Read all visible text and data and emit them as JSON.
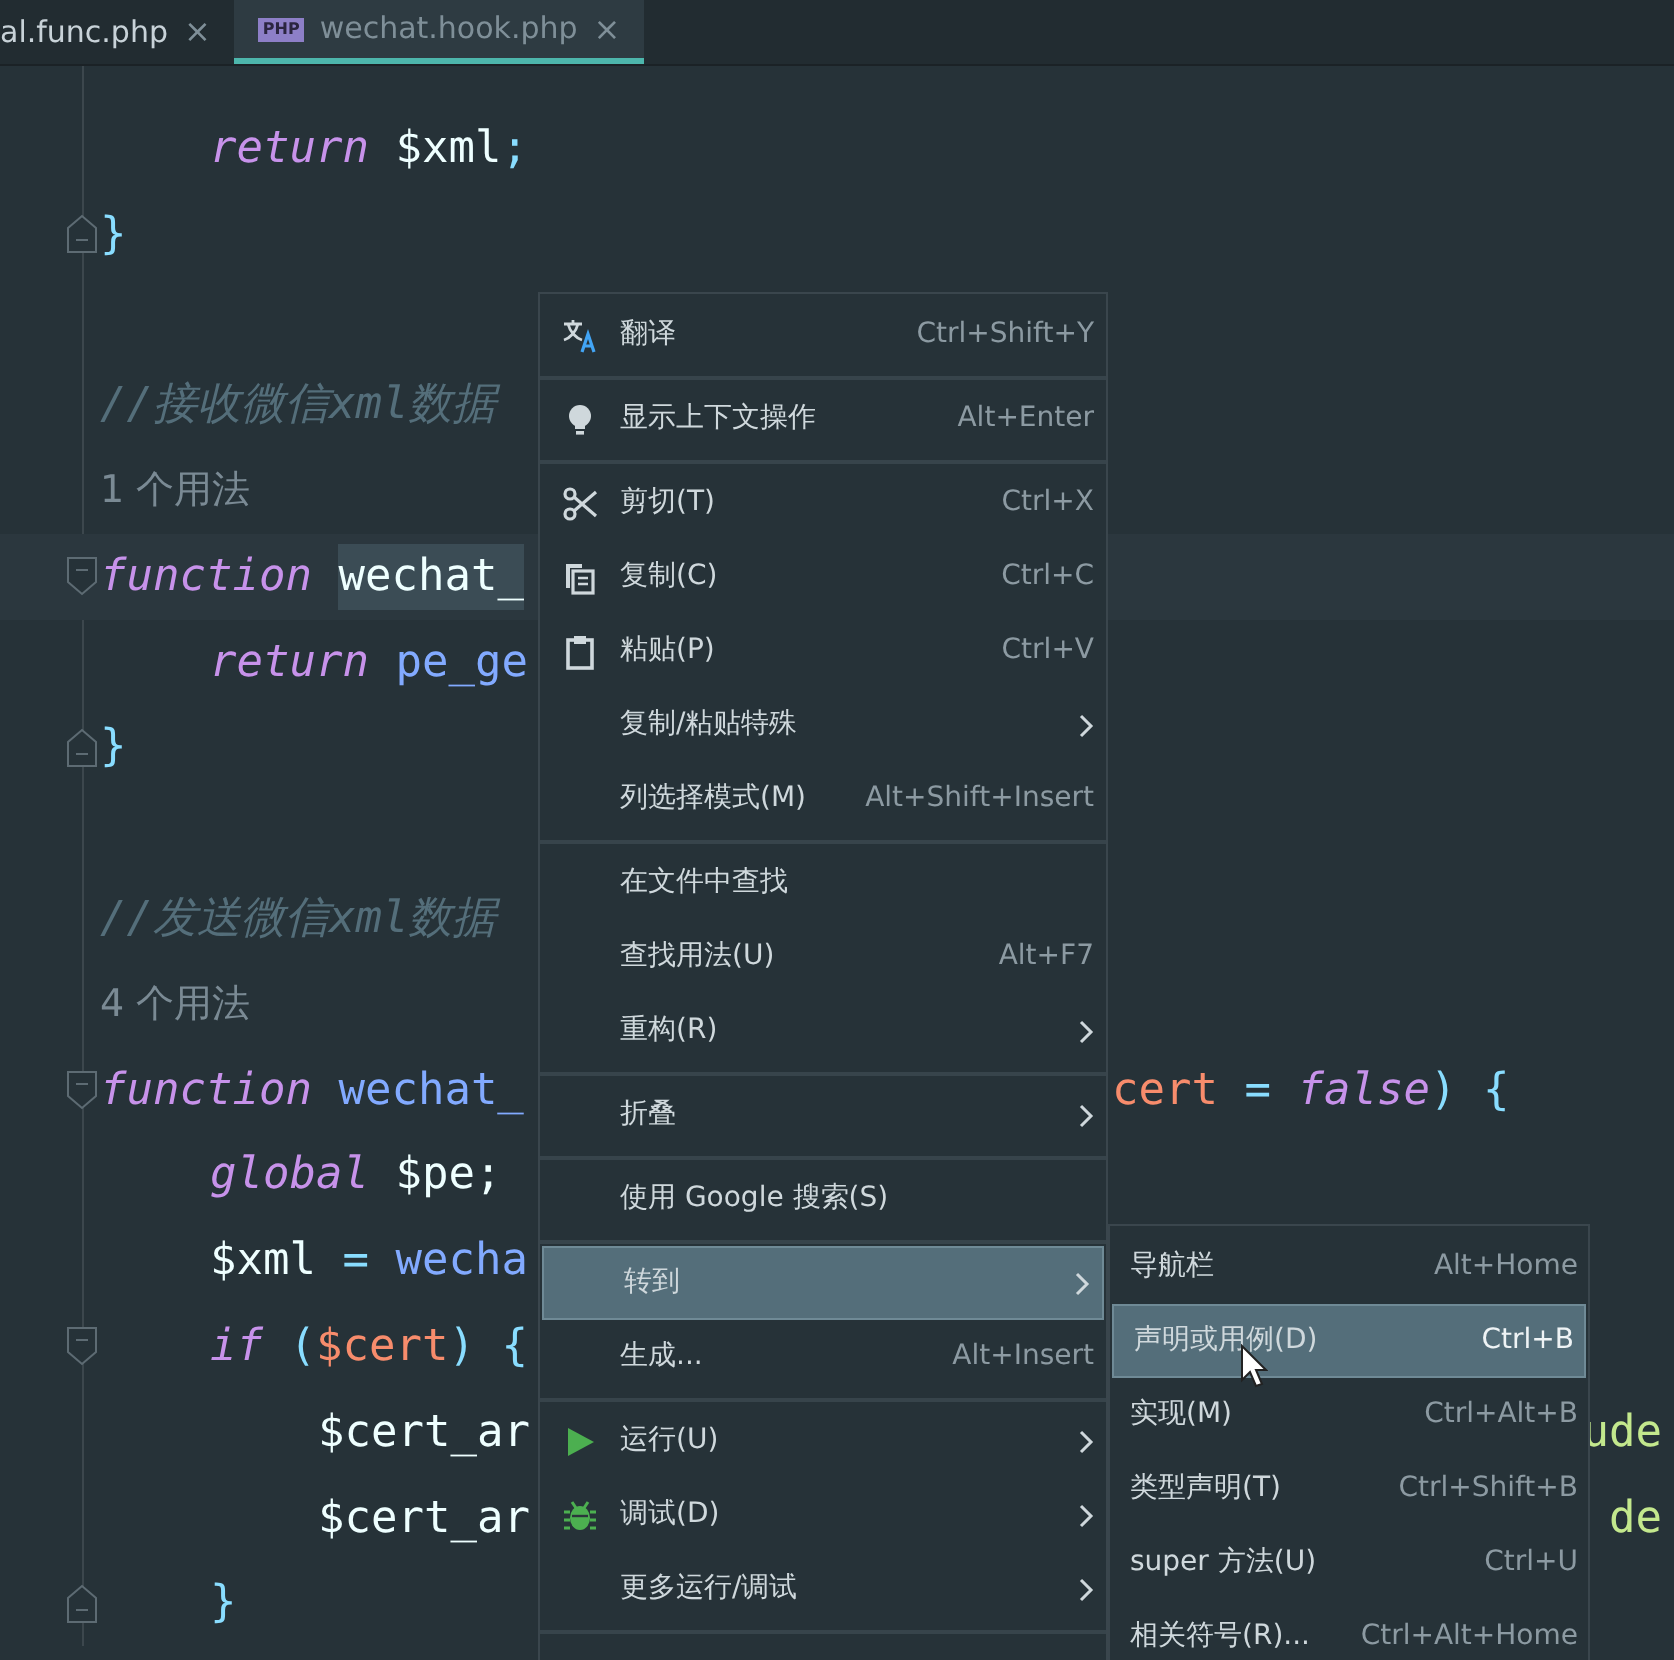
{
  "tabs": [
    {
      "label": "al.func.php",
      "close": "×",
      "selected": false
    },
    {
      "label": "wechat.hook.php",
      "close": "×",
      "selected": true,
      "file_badge": "PHP"
    }
  ],
  "code_lines": [
    {
      "kind": "group",
      "children": [
        {
          "kind": "code",
          "tokens": [
            {
              "text": "return",
              "kind": "keyword"
            },
            {
              "text": " $xml",
              "kind": "var"
            },
            {
              "text": ";",
              "kind": "punct"
            }
          ]
        }
      ]
    },
    {
      "kind": "fold-end",
      "tokens": [
        {
          "text": "}",
          "kind": "punct"
        }
      ]
    },
    {
      "kind": "blank"
    },
    {
      "kind": "code",
      "tokens": [
        {
          "text": "//接收微信xml数据",
          "kind": "comment"
        }
      ]
    },
    {
      "kind": "code",
      "tokens": [
        {
          "text": "1 个用法",
          "kind": "hint"
        }
      ]
    },
    {
      "kind": "fold-start",
      "current": true,
      "tokens": [
        {
          "text": "function ",
          "kind": "keyword"
        },
        {
          "text": "wechat_",
          "kind": "plain",
          "selected": true
        }
      ],
      "children": [
        {
          "kind": "code",
          "tokens": [
            {
              "text": "return",
              "kind": "keyword"
            },
            {
              "text": " pe_ge",
              "kind": "fn"
            }
          ]
        }
      ]
    },
    {
      "kind": "fold-end",
      "tokens": [
        {
          "text": "}",
          "kind": "punct"
        }
      ]
    },
    {
      "kind": "blank"
    },
    {
      "kind": "code",
      "tokens": [
        {
          "text": "//发送微信xml数据",
          "kind": "comment"
        }
      ]
    },
    {
      "kind": "code",
      "tokens": [
        {
          "text": "4 个用法",
          "kind": "hint"
        }
      ]
    },
    {
      "kind": "fold-start",
      "tokens": [
        {
          "text": "function",
          "kind": "keyword"
        },
        {
          "text": " wechat_",
          "kind": "fn"
        }
      ],
      "right": [
        {
          "text": "cert",
          "kind": "param"
        },
        {
          "text": " = ",
          "kind": "punct"
        },
        {
          "text": "false",
          "kind": "keyword"
        },
        {
          "text": ") {",
          "kind": "punct"
        }
      ],
      "children": [
        {
          "kind": "code",
          "tokens": [
            {
              "text": "global",
              "kind": "keyword"
            },
            {
              "text": " $pe;",
              "kind": "var"
            }
          ]
        },
        {
          "kind": "code",
          "tokens": [
            {
              "text": "$xml",
              "kind": "var"
            },
            {
              "text": " = ",
              "kind": "punct"
            },
            {
              "text": "wecha",
              "kind": "fn"
            }
          ]
        },
        {
          "kind": "fold-start",
          "tokens": [
            {
              "text": "if",
              "kind": "keyword"
            },
            {
              "text": " (",
              "kind": "punct"
            },
            {
              "text": "$cert",
              "kind": "param"
            },
            {
              "text": ") {",
              "kind": "punct"
            }
          ],
          "children": [
            {
              "kind": "code",
              "tokens": [
                {
                  "text": "$cert_ar",
                  "kind": "var"
                }
              ],
              "right": [
                {
                  "text": "ude",
                  "kind": "string"
                }
              ]
            },
            {
              "kind": "code",
              "tokens": [
                {
                  "text": "$cert_ar",
                  "kind": "var"
                }
              ],
              "right": [
                {
                  "text": "de",
                  "kind": "string"
                }
              ]
            }
          ]
        },
        {
          "kind": "fold-end",
          "tokens": [
            {
              "text": "}",
              "kind": "punct"
            }
          ]
        }
      ]
    }
  ],
  "context_menu": {
    "items": [
      {
        "kind": "item",
        "label": "翻译",
        "shortcut": "Ctrl+Shift+Y"
      },
      {
        "kind": "separator"
      },
      {
        "kind": "item",
        "label": "显示上下文操作",
        "shortcut": "Alt+Enter"
      },
      {
        "kind": "separator"
      },
      {
        "kind": "item",
        "label": "剪切(T)",
        "shortcut": "Ctrl+X"
      },
      {
        "kind": "item",
        "label": "复制(C)",
        "shortcut": "Ctrl+C"
      },
      {
        "kind": "item",
        "label": "粘贴(P)",
        "shortcut": "Ctrl+V"
      },
      {
        "kind": "submenu",
        "label": "复制/粘贴特殊",
        "selected": false
      },
      {
        "kind": "item",
        "label": "列选择模式(M)",
        "shortcut": "Alt+Shift+Insert"
      },
      {
        "kind": "separator"
      },
      {
        "kind": "item",
        "label": "在文件中查找"
      },
      {
        "kind": "item",
        "label": "查找用法(U)",
        "shortcut": "Alt+F7"
      },
      {
        "kind": "submenu",
        "label": "重构(R)",
        "selected": false
      },
      {
        "kind": "separator"
      },
      {
        "kind": "submenu",
        "label": "折叠",
        "selected": false
      },
      {
        "kind": "separator"
      },
      {
        "kind": "item",
        "label": "使用 Google 搜索(S)"
      },
      {
        "kind": "separator"
      },
      {
        "kind": "submenu",
        "label": "转到",
        "selected": true
      },
      {
        "kind": "item",
        "label": "生成...",
        "shortcut": "Alt+Insert"
      },
      {
        "kind": "separator"
      },
      {
        "kind": "submenu",
        "label": "运行(U)",
        "selected": false
      },
      {
        "kind": "submenu",
        "label": "调试(D)",
        "selected": false
      },
      {
        "kind": "submenu",
        "label": "更多运行/调试",
        "selected": false
      },
      {
        "kind": "separator"
      }
    ]
  },
  "submenu": {
    "items": [
      {
        "label": "导航栏",
        "shortcut": "Alt+Home",
        "selected": false
      },
      {
        "label": "声明或用例(D)",
        "shortcut": "Ctrl+B",
        "selected": true
      },
      {
        "label": "实现(M)",
        "shortcut": "Ctrl+Alt+B",
        "selected": false
      },
      {
        "label": "类型声明(T)",
        "shortcut": "Ctrl+Shift+B",
        "selected": false
      },
      {
        "label": "super 方法(U)",
        "shortcut": "Ctrl+U",
        "selected": false
      },
      {
        "label": "相关符号(R)...",
        "shortcut": "Ctrl+Alt+Home",
        "selected": false
      }
    ]
  }
}
